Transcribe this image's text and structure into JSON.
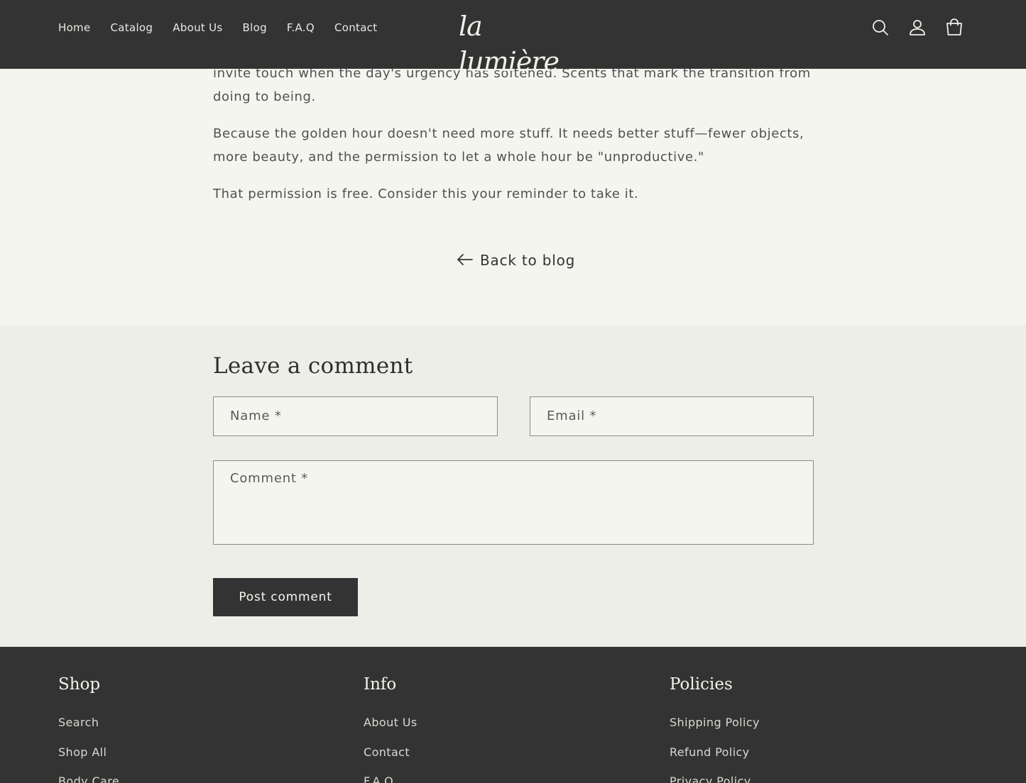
{
  "header": {
    "nav": [
      "Home",
      "Catalog",
      "About Us",
      "Blog",
      "F.A.Q",
      "Contact"
    ],
    "logo": "la lumière",
    "icons": [
      "search-icon",
      "account-icon",
      "cart-icon"
    ]
  },
  "article": {
    "paragraphs": [
      "invite touch when the day's urgency has softened. Scents that mark the transition from doing to being.",
      "Because the golden hour doesn't need more stuff. It needs better stuff—fewer objects, more beauty, and the permission to let a whole hour be \"unproductive.\"",
      "That permission is free. Consider this your reminder to take it."
    ],
    "back_link": "Back to blog"
  },
  "comment_form": {
    "title": "Leave a comment",
    "name_placeholder": "Name *",
    "email_placeholder": "Email *",
    "comment_placeholder": "Comment *",
    "submit_label": "Post comment"
  },
  "footer": {
    "shop": {
      "title": "Shop",
      "links": [
        "Search",
        "Shop All",
        "Body Care"
      ]
    },
    "info": {
      "title": "Info",
      "links": [
        "About Us",
        "Contact",
        "F.A.Q"
      ]
    },
    "policies": {
      "title": "Policies",
      "links": [
        "Shipping Policy",
        "Refund Policy",
        "Privacy Policy"
      ]
    }
  },
  "colors": {
    "header_bg": "#333333",
    "page_bg": "#f5f5f0",
    "comment_bg": "#eeeee9",
    "button_bg": "#333333"
  }
}
